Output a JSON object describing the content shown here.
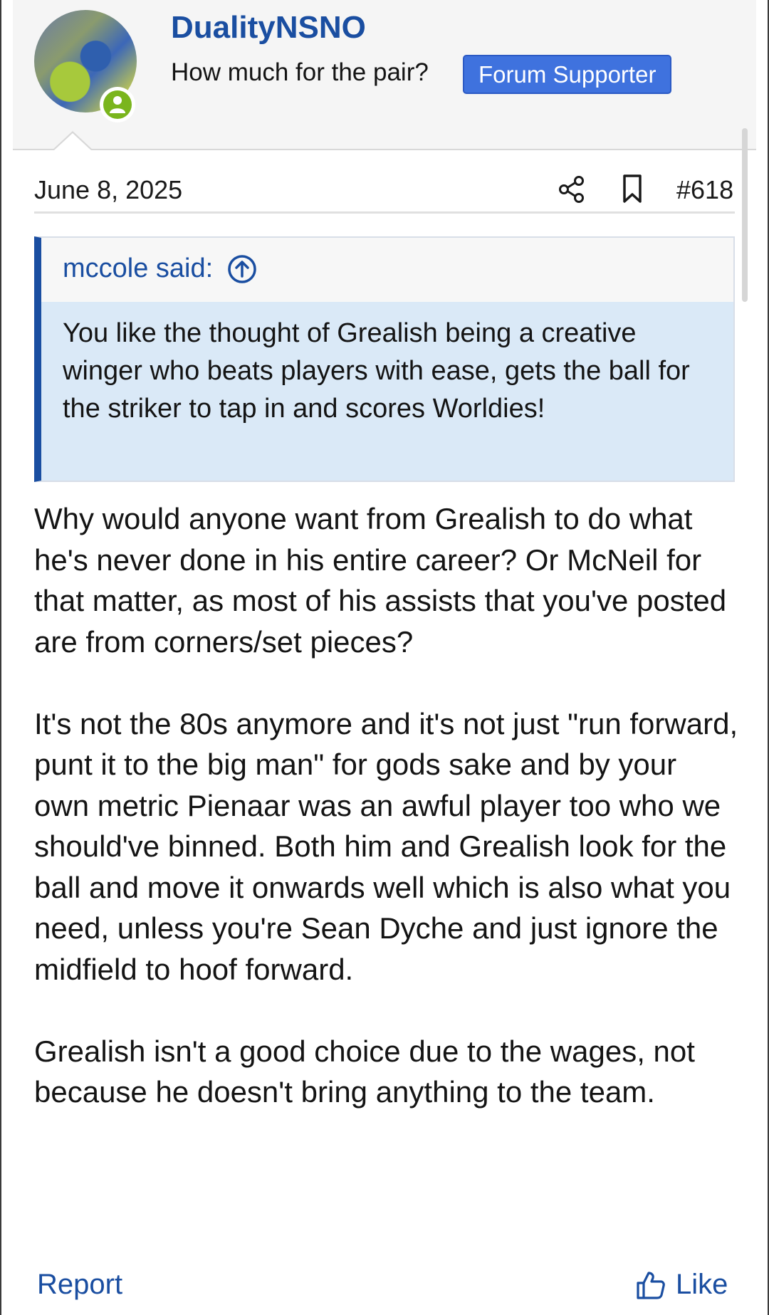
{
  "post": {
    "author": {
      "username": "DualityNSNO",
      "user_title": "How much for the pair?",
      "banner": "Forum Supporter",
      "status": "online"
    },
    "date": "June 8, 2025",
    "post_number": "#618",
    "quote": {
      "attribution": "mccole said:",
      "text": "You like the thought of Grealish being a creative winger who beats players with ease, gets the ball for the striker to tap in and scores Worldies!"
    },
    "paragraphs": [
      "Why would anyone want from Grealish to do what he's never done in his entire career? Or McNeil for that matter, as most of his assists that you've posted are from corners/set pieces?",
      "It's not the 80s anymore and it's not just \"run forward, punt it to the big man\" for gods sake and by your own metric Pienaar was an awful player too who we should've binned. Both him and Grealish look for the ball and move it onwards well which is also what you need, unless you're Sean Dyche and just ignore the midfield to hoof forward.",
      "Grealish isn't a good choice due to the wages, not because he doesn't bring anything to the team."
    ],
    "actions": {
      "report": "Report",
      "like": "Like"
    }
  },
  "icons": {
    "share": "share-icon",
    "bookmark": "bookmark-icon",
    "quote_jump": "arrow-up-circle-icon",
    "like": "thumbs-up-icon",
    "online": "user-online-icon"
  },
  "colors": {
    "link": "#1a4ea1",
    "banner_bg": "#3f72de",
    "quote_bg": "#dae9f7",
    "online": "#7ab51d"
  }
}
